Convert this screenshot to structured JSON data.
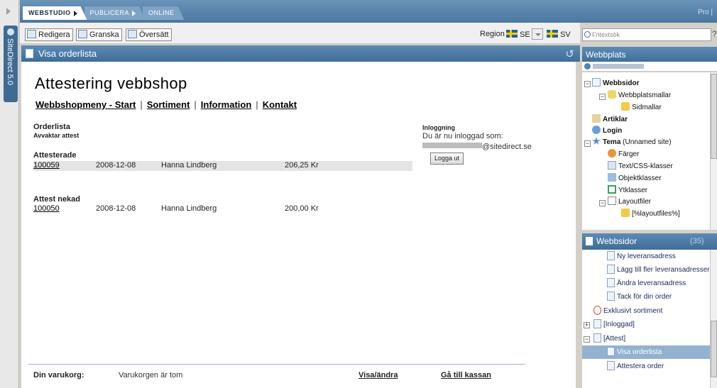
{
  "app": {
    "vertical_tab": "SiteDirect 5.0",
    "top_tabs": [
      "WEBSTUDIO",
      "PUBLICERA",
      "ONLINE"
    ],
    "top_right": "Pro |"
  },
  "toolbar": {
    "edit": "Redigera",
    "review": "Granska",
    "translate": "Översätt",
    "region_label": "Region",
    "region_value": "SE",
    "language_value": "SV"
  },
  "panel": {
    "title": "Visa orderlista"
  },
  "page": {
    "heading": "Attestering  vebbshop",
    "nav": [
      "Webbshopmeny - Start",
      "Sortiment",
      "Information",
      "Kontakt"
    ],
    "orderlist_title": "Orderlista",
    "orderlist_sub": "Avvaktar attest",
    "sections": [
      {
        "title": "Attesterade",
        "rows": [
          {
            "id": "100059",
            "date": "2008-12-08",
            "name": "Hanna Lindberg",
            "amount": "206,25 Kr"
          }
        ]
      },
      {
        "title": "Attest nekad",
        "rows": [
          {
            "id": "100050",
            "date": "2008-12-08",
            "name": "Hanna Lindberg",
            "amount": "200,00 Kr"
          }
        ]
      }
    ],
    "login": {
      "heading": "Inloggning",
      "text": "Du är nu inloggad som:",
      "email_domain": "@sitedirect.se",
      "logout": "Logga ut"
    },
    "footer": {
      "cart_label": "Din varukorg:",
      "cart_status": "Varukorgen är tom",
      "view_edit": "Visa/ändra",
      "checkout": "Gå till kassan"
    }
  },
  "sidebar": {
    "search_placeholder": "Fritextsök",
    "website_title": "Webbplats",
    "tree": [
      {
        "label": "Webbsidor",
        "bold": true
      },
      {
        "label": "Webbplatsmallar"
      },
      {
        "label": "Sidmallar"
      },
      {
        "label": "Artiklar",
        "bold": true
      },
      {
        "label": "Login",
        "bold": true
      },
      {
        "label": "Tema",
        "suffix": "(Unnamed site)",
        "bold": true
      },
      {
        "label": "Färger"
      },
      {
        "label": "Text/CSS-klasser"
      },
      {
        "label": "Objektklasser"
      },
      {
        "label": "Ytklasser"
      },
      {
        "label": "Layoutfiler"
      },
      {
        "label": "[%layoutfiles%]"
      }
    ],
    "pages_title": "Webbsidor",
    "pages_count": "(35)",
    "pages": [
      {
        "label": "Ny leveransadress"
      },
      {
        "label": "Lägg till fler leveransadresser"
      },
      {
        "label": "Ändra leveransadress"
      },
      {
        "label": "Tack för din order"
      },
      {
        "label": "Exklusivt sortiment"
      },
      {
        "label": "[Inloggad]"
      },
      {
        "label": "[Attest]"
      },
      {
        "label": "Visa orderlista",
        "selected": true
      },
      {
        "label": "Attestera order"
      }
    ]
  }
}
